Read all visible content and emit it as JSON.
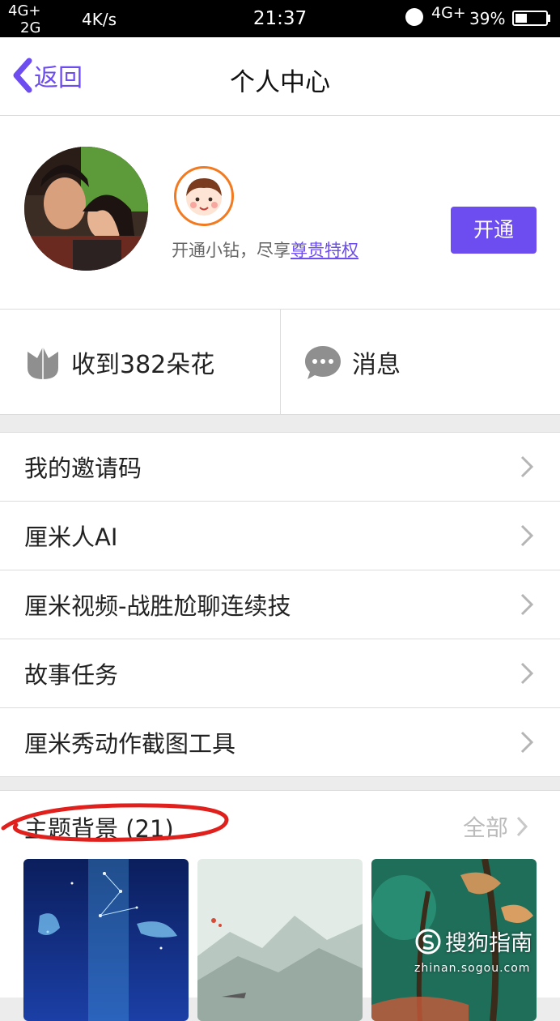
{
  "status_bar": {
    "network_top": "4G+",
    "network_bottom": "2G",
    "speed": "4K/s",
    "time": "21:37",
    "network_right": "4G+",
    "battery": "39%",
    "battery_level": 0.39
  },
  "nav": {
    "back_label": "返回",
    "title": "个人中心"
  },
  "profile": {
    "vip_text": "开通小钻，尽享",
    "vip_link": "尊贵特权",
    "open_button": "开通"
  },
  "stats": {
    "flowers": "收到382朵花",
    "messages": "消息"
  },
  "menu": {
    "items": [
      {
        "label": "我的邀请码"
      },
      {
        "label": "厘米人AI"
      },
      {
        "label": "厘米视频-战胜尬聊连续技"
      },
      {
        "label": "故事任务"
      },
      {
        "label": "厘米秀动作截图工具"
      }
    ]
  },
  "themes": {
    "title": "主题背景 (21)",
    "all_label": "全部"
  },
  "watermark": {
    "brand": "搜狗指南",
    "url": "zhinan.sogou.com"
  },
  "colors": {
    "accent": "#6d4cf0",
    "badge_ring": "#f27a21",
    "annotation": "#e0201c"
  }
}
